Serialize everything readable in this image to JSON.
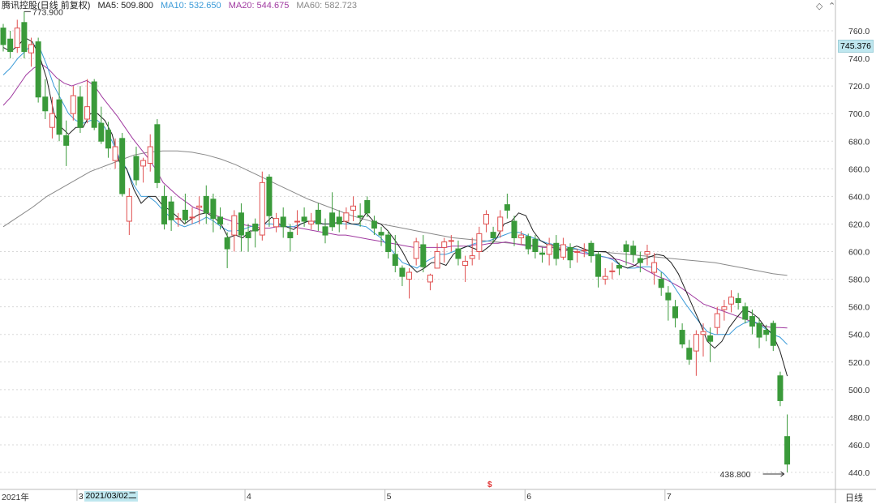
{
  "legend": {
    "title": "腾讯控股(日线 前复权)",
    "ma5": "MA5: 509.800",
    "ma10": "MA10: 532.650",
    "ma20": "MA20: 544.675",
    "ma60": "MA60: 582.723"
  },
  "colors": {
    "up": "#e05050",
    "down": "#3a9a3a",
    "ma5": "#222222",
    "ma10": "#3a9ad8",
    "ma20": "#a03aa0",
    "ma60": "#888888",
    "grid": "#d8d8d8",
    "highlight": "#bfe7ef"
  },
  "current_price": "745.376",
  "selected_date": "2021/03/02二",
  "year_label": "2021年",
  "period_label": "日线",
  "dollar_marker": "$",
  "chart_data": {
    "type": "candlestick",
    "ylim": [
      430,
      775
    ],
    "y_ticks": [
      "760.0",
      "740.0",
      "720.0",
      "700.0",
      "680.0",
      "660.0",
      "640.0",
      "620.0",
      "600.0",
      "580.0",
      "560.0",
      "540.0",
      "520.0",
      "500.0",
      "480.0",
      "460.0",
      "440.0"
    ],
    "x_ticks": [
      "3",
      "4",
      "5",
      "6",
      "7"
    ],
    "annotations": {
      "max": "773.900",
      "min": "438.800"
    },
    "candles": [
      [
        762,
        750,
        765,
        745
      ],
      [
        754,
        745,
        760,
        740
      ],
      [
        748,
        762,
        768,
        744
      ],
      [
        766,
        745,
        774,
        740
      ],
      [
        744,
        750,
        755,
        734
      ],
      [
        752,
        712,
        755,
        708
      ],
      [
        712,
        702,
        725,
        696
      ],
      [
        690,
        700,
        712,
        682
      ],
      [
        710,
        685,
        725,
        680
      ],
      [
        684,
        677,
        695,
        662
      ],
      [
        700,
        713,
        720,
        695
      ],
      [
        712,
        690,
        720,
        686
      ],
      [
        696,
        705,
        725,
        693
      ],
      [
        723,
        690,
        725,
        688
      ],
      [
        693,
        680,
        705,
        678
      ],
      [
        688,
        675,
        694,
        668
      ],
      [
        666,
        676,
        682,
        660
      ],
      [
        682,
        642,
        686,
        640
      ],
      [
        622,
        640,
        646,
        612
      ],
      [
        669,
        652,
        676,
        648
      ],
      [
        662,
        666,
        668,
        650
      ],
      [
        664,
        676,
        685,
        658
      ],
      [
        692,
        650,
        696,
        646
      ],
      [
        640,
        620,
        648,
        616
      ],
      [
        636,
        623,
        640,
        615
      ],
      [
        624,
        624,
        628,
        618
      ],
      [
        630,
        623,
        642,
        620
      ],
      [
        625,
        625,
        632,
        620
      ],
      [
        632,
        633,
        640,
        620
      ],
      [
        640,
        628,
        648,
        620
      ],
      [
        638,
        624,
        642,
        614
      ],
      [
        625,
        620,
        632,
        616
      ],
      [
        610,
        602,
        614,
        588
      ],
      [
        612,
        626,
        630,
        600
      ],
      [
        628,
        612,
        635,
        600
      ],
      [
        614,
        610,
        620,
        600
      ],
      [
        620,
        615,
        624,
        603
      ],
      [
        612,
        650,
        658,
        608
      ],
      [
        654,
        626,
        656,
        618
      ],
      [
        618,
        624,
        628,
        614
      ],
      [
        625,
        618,
        632,
        610
      ],
      [
        614,
        610,
        620,
        600
      ],
      [
        622,
        622,
        630,
        612
      ],
      [
        625,
        622,
        632,
        618
      ],
      [
        620,
        622,
        628,
        616
      ],
      [
        630,
        620,
        635,
        615
      ],
      [
        618,
        612,
        624,
        606
      ],
      [
        628,
        618,
        643,
        615
      ],
      [
        625,
        620,
        630,
        614
      ],
      [
        622,
        628,
        632,
        616
      ],
      [
        630,
        633,
        640,
        622
      ],
      [
        626,
        625,
        635,
        618
      ],
      [
        637,
        628,
        640,
        625
      ],
      [
        622,
        617,
        626,
        612
      ],
      [
        614,
        612,
        618,
        604
      ],
      [
        612,
        600,
        615,
        595
      ],
      [
        598,
        590,
        612,
        585
      ],
      [
        588,
        582,
        590,
        575
      ],
      [
        580,
        585,
        588,
        566
      ],
      [
        595,
        607,
        610,
        590
      ],
      [
        605,
        589,
        612,
        585
      ],
      [
        578,
        583,
        584,
        572
      ],
      [
        588,
        600,
        606,
        590
      ],
      [
        603,
        607,
        610,
        592
      ],
      [
        608,
        608,
        612,
        600
      ],
      [
        602,
        595,
        608,
        590
      ],
      [
        590,
        593,
        597,
        578
      ],
      [
        595,
        597,
        610,
        590
      ],
      [
        600,
        613,
        618,
        594
      ],
      [
        620,
        627,
        630,
        614
      ],
      [
        614,
        610,
        618,
        606
      ],
      [
        615,
        625,
        630,
        610
      ],
      [
        634,
        630,
        642,
        624
      ],
      [
        622,
        610,
        626,
        604
      ],
      [
        610,
        612,
        615,
        605
      ],
      [
        611,
        602,
        613,
        598
      ],
      [
        609,
        600,
        612,
        595
      ],
      [
        599,
        598,
        603,
        592
      ],
      [
        598,
        605,
        610,
        590
      ],
      [
        606,
        595,
        612,
        590
      ],
      [
        596,
        605,
        610,
        594
      ],
      [
        603,
        594,
        606,
        588
      ],
      [
        600,
        600,
        602,
        592
      ],
      [
        601,
        601,
        606,
        596
      ],
      [
        606,
        597,
        608,
        592
      ],
      [
        598,
        582,
        600,
        574
      ],
      [
        580,
        582,
        588,
        576
      ],
      [
        586,
        586,
        592,
        580
      ],
      [
        590,
        588,
        592,
        583
      ],
      [
        605,
        600,
        608,
        590
      ],
      [
        604,
        598,
        608,
        592
      ],
      [
        595,
        592,
        600,
        585
      ],
      [
        598,
        600,
        605,
        590
      ],
      [
        585,
        592,
        599,
        576
      ],
      [
        580,
        574,
        585,
        568
      ],
      [
        570,
        565,
        575,
        550
      ],
      [
        560,
        552,
        565,
        545
      ],
      [
        543,
        533,
        548,
        530
      ],
      [
        530,
        522,
        536,
        518
      ],
      [
        528,
        540,
        543,
        510
      ],
      [
        540,
        542,
        548,
        524
      ],
      [
        539,
        535,
        545,
        520
      ],
      [
        545,
        555,
        560,
        540
      ],
      [
        558,
        560,
        565,
        550
      ],
      [
        562,
        567,
        572,
        556
      ],
      [
        566,
        563,
        570,
        558
      ],
      [
        560,
        551,
        563,
        548
      ],
      [
        553,
        546,
        558,
        540
      ],
      [
        548,
        538,
        552,
        530
      ],
      [
        543,
        540,
        547,
        535
      ],
      [
        548,
        532,
        550,
        528
      ],
      [
        510,
        492,
        513,
        488
      ],
      [
        466,
        446,
        482,
        440
      ]
    ],
    "ma5": [
      748,
      745,
      749,
      755,
      752,
      742,
      725,
      700,
      690,
      685,
      690,
      690,
      700,
      700,
      695,
      685,
      665,
      660,
      645,
      635,
      640,
      640,
      633,
      630,
      625,
      620,
      624,
      627,
      628,
      625,
      620,
      610,
      612,
      610,
      615,
      615,
      620,
      625,
      620,
      618,
      616,
      620,
      622,
      622,
      620,
      620,
      621,
      622,
      620,
      620,
      628,
      622,
      620,
      615,
      608,
      600,
      590,
      585,
      588,
      592,
      592,
      590,
      598,
      602,
      604,
      602,
      600,
      604,
      610,
      620,
      622,
      628,
      626,
      615,
      608,
      605,
      604,
      600,
      602,
      604,
      602,
      600,
      600,
      600,
      596,
      590,
      588,
      590,
      594,
      596,
      598,
      597,
      592,
      584,
      572,
      560,
      548,
      535,
      530,
      535,
      545,
      552,
      558,
      556,
      552,
      545,
      540,
      528,
      509.8
    ],
    "ma10": [
      728,
      733,
      740,
      745,
      750,
      748,
      735,
      720,
      710,
      700,
      695,
      693,
      695,
      695,
      690,
      680,
      668,
      660,
      648,
      640,
      640,
      636,
      630,
      625,
      620,
      618,
      620,
      622,
      625,
      622,
      618,
      615,
      615,
      616,
      618,
      619,
      620,
      620,
      619,
      618,
      618,
      620,
      622,
      621,
      620,
      620,
      621,
      620,
      620,
      619,
      618,
      614,
      610,
      604,
      598,
      592,
      590,
      588,
      592,
      595,
      598,
      598,
      600,
      602,
      604,
      606,
      607,
      608,
      610,
      612,
      614,
      614,
      612,
      610,
      608,
      606,
      605,
      604,
      603,
      602,
      600,
      598,
      597,
      596,
      594,
      590,
      588,
      588,
      589,
      589,
      588,
      584,
      578,
      570,
      562,
      555,
      548,
      542,
      540,
      540,
      540,
      545,
      548,
      550,
      548,
      544,
      540,
      538,
      532.65
    ],
    "ma20": [
      706,
      712,
      720,
      728,
      733,
      736,
      732,
      726,
      722,
      720,
      722,
      724,
      720,
      712,
      705,
      698,
      690,
      682,
      675,
      668,
      660,
      650,
      645,
      640,
      636,
      632,
      630,
      628,
      626,
      624,
      622,
      620,
      619,
      618,
      617,
      617,
      618,
      618,
      618,
      617,
      616,
      615,
      614,
      613,
      612,
      612,
      611,
      610,
      609,
      608,
      607,
      606,
      605,
      604,
      603,
      603,
      603,
      603,
      603,
      604,
      604,
      604,
      605,
      605,
      606,
      606,
      607,
      606,
      605,
      604,
      604,
      603,
      603,
      602,
      601,
      600,
      599,
      598,
      597,
      596,
      595,
      594,
      592,
      590,
      588,
      585,
      582,
      580,
      577,
      574,
      570,
      566,
      562,
      560,
      558,
      556,
      554,
      552,
      550,
      548,
      546,
      545,
      545,
      544.675
    ],
    "ma60": [
      618,
      625,
      632,
      640,
      646,
      652,
      658,
      662,
      666,
      670,
      672,
      673,
      673,
      672,
      670,
      667,
      663,
      658,
      653,
      648,
      643,
      638,
      634,
      630,
      626,
      623,
      620,
      618,
      616,
      614,
      612,
      610,
      609,
      608,
      607,
      606,
      605,
      604,
      603,
      602,
      601,
      600,
      599,
      598,
      597,
      596,
      595,
      594,
      593,
      592,
      590,
      588,
      586,
      584,
      582.723
    ]
  }
}
